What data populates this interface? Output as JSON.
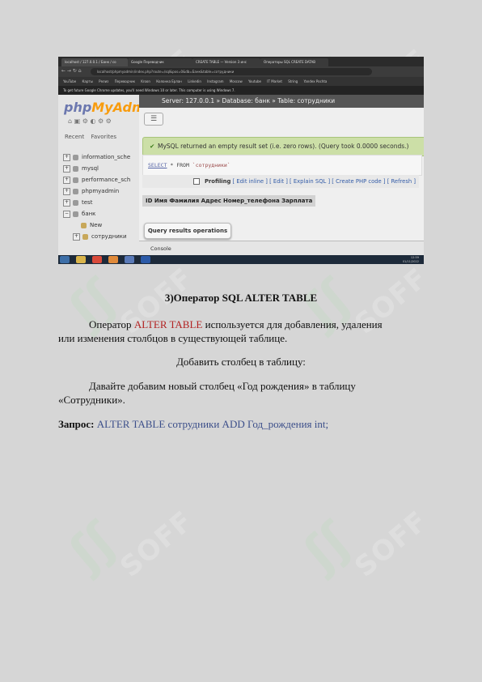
{
  "browser": {
    "tabs": [
      "localhost / 127.0.0.1 / Банк / со",
      "Google Переводчик",
      "CREATE TABLE — Version 3 инс",
      "Операторы SQL CREATE DATAB"
    ],
    "url": "localhost/phpmyadmin/index.php?route=/sql&pos=0&db=Банк&table=сотрудники",
    "bookmarks": [
      "YouTube",
      "Карты",
      "Релиз",
      "Переводчик",
      "Kroon",
      "Колонка Ерлан",
      "Linkedin",
      "Instagram",
      "Moscow",
      "Youtube",
      "IT Market",
      "String",
      "Yandex Pochta"
    ],
    "warning": "To get future Google Chrome updates, you'll need Windows 10 or later. This computer is using Windows 7."
  },
  "pma": {
    "logo_php": "php",
    "logo_my": "MyAdmin",
    "nav_recent": "Recent",
    "nav_favorites": "Favorites",
    "databases": [
      "information_sche",
      "mysql",
      "performance_sch",
      "phpmyadmin",
      "test",
      "банк"
    ],
    "sub_items": [
      "New",
      "сотрудники"
    ],
    "breadcrumb": "Server: 127.0.0.1 » Database: банк » Table: сотрудники",
    "success_msg": "MySQL returned an empty result set (i.e. zero rows). (Query took 0.0000 seconds.)",
    "sql_select": "SELECT",
    "sql_rest": " * FROM ",
    "sql_table": "`сотрудники`",
    "profiling": "Profiling",
    "links": "[ Edit inline ] [ Edit ] [ Explain SQL ] [ Create PHP code ] [ Refresh ]",
    "columns": "ID  Имя  Фамилия  Адрес  Номер_телефона  Зарплата",
    "qro": "Query results operations",
    "console": "Console"
  },
  "taskbar": {
    "time": "12:59",
    "date": "01/11/2022"
  },
  "doc": {
    "heading": "3)Оператор SQL ALTER TABLE",
    "p1_a": "Оператор ",
    "p1_red": "ALTER TABLE",
    "p1_b": " используется для добавления, удаления",
    "p1_line2": "или изменения столбцов в существующей таблице.",
    "p2": "Добавить столбец в таблицу:",
    "p3_line1": "Давайте добавим новый столбец «Год рождения» в таблицу",
    "p3_line2": "«Сотрудники».",
    "query_label": "Запрос:",
    "query_text": " ALTER TABLE сотрудники ADD Год_рождения int;"
  },
  "watermark": "SOFF"
}
